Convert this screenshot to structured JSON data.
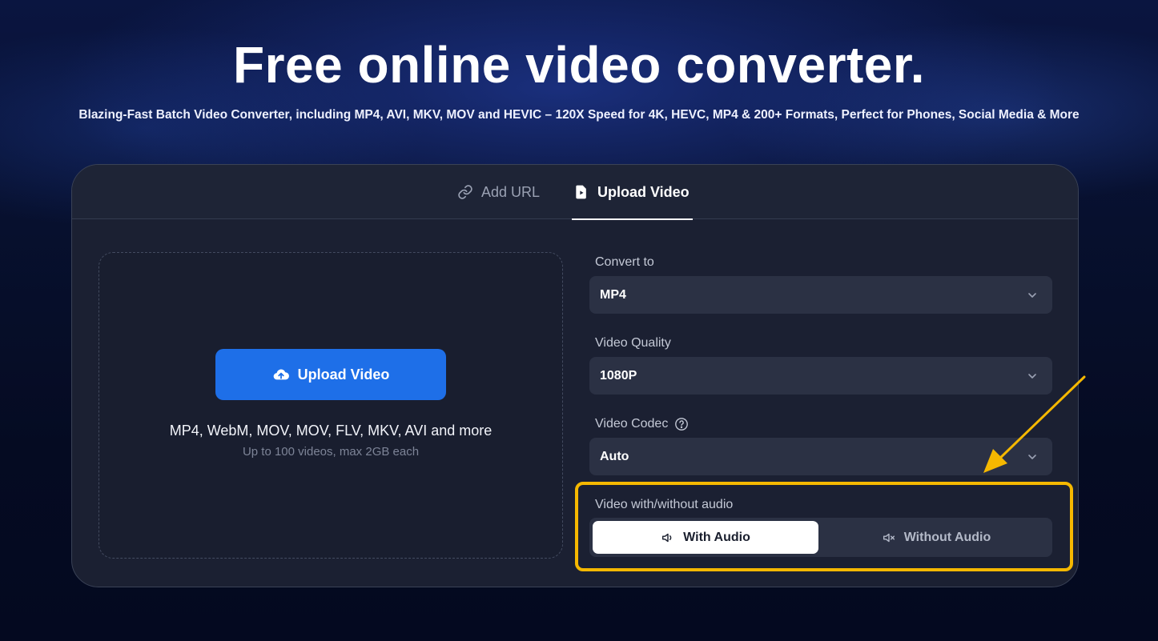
{
  "hero": {
    "title": "Free online video converter.",
    "subtitle": "Blazing-Fast Batch Video Converter, including MP4, AVI, MKV, MOV and HEVIC – 120X Speed for 4K, HEVC, MP4 & 200+ Formats, Perfect for Phones, Social Media & More"
  },
  "tabs": [
    {
      "label": "Add URL",
      "icon": "link-icon",
      "active": false
    },
    {
      "label": "Upload Video",
      "icon": "file-icon",
      "active": true
    }
  ],
  "dropzone": {
    "button_label": "Upload Video",
    "button_icon": "cloud-upload-icon",
    "formats": "MP4, WebM, MOV, MOV, FLV, MKV, AVI and more",
    "limits": "Up to 100 videos, max 2GB each"
  },
  "settings": {
    "convert_to": {
      "label": "Convert to",
      "value": "MP4"
    },
    "quality": {
      "label": "Video Quality",
      "value": "1080P"
    },
    "codec": {
      "label": "Video Codec",
      "value": "Auto"
    },
    "audio": {
      "label": "Video with/without audio",
      "options": [
        {
          "label": "With Audio",
          "icon": "speaker-icon",
          "selected": true
        },
        {
          "label": "Without Audio",
          "icon": "speaker-muted-icon",
          "selected": false
        }
      ]
    }
  },
  "colors": {
    "accent_blue": "#1e6fe8",
    "highlight": "#f5b800",
    "card_bg": "#1b2032",
    "field_bg": "#2b3144"
  }
}
